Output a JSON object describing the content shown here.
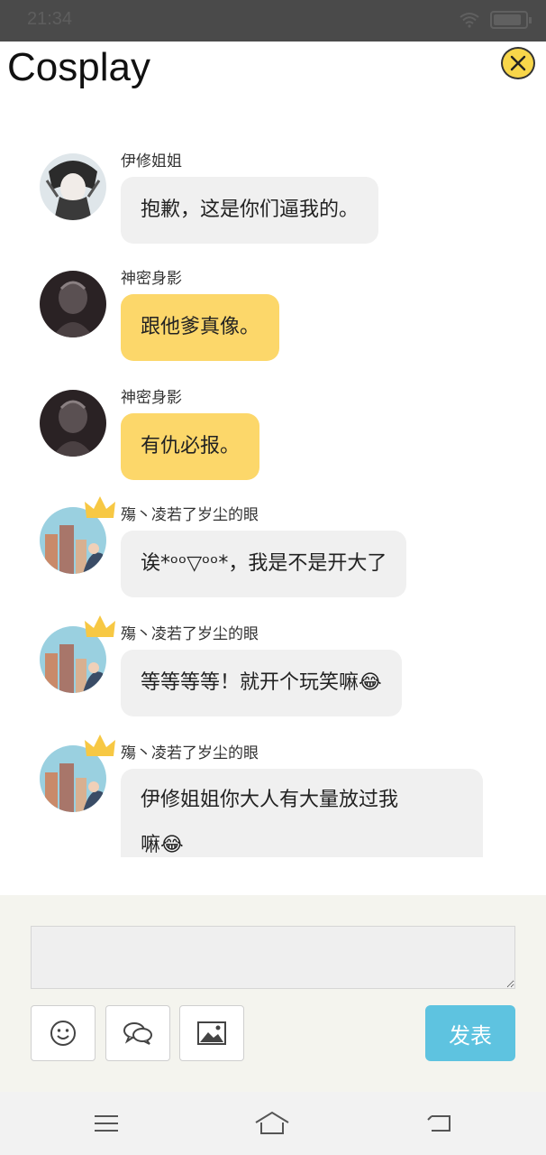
{
  "status_bar": {
    "time": "21:34"
  },
  "header": {
    "title": "Cosplay"
  },
  "messages": [
    {
      "sender": "伊修姐姐",
      "text": "抱歉，这是你们逼我的。",
      "style": "grey",
      "avatar": "avatar-ishu"
    },
    {
      "sender": "神密身影",
      "text": "跟他爹真像。",
      "style": "yellow",
      "avatar": "avatar-mystery"
    },
    {
      "sender": "神密身影",
      "text": "有仇必报。",
      "style": "yellow",
      "avatar": "avatar-mystery"
    },
    {
      "sender": "殤丶凌若了岁尘的眼",
      "text": "诶*ᵒᵒ▽ᵒᵒ*，我是不是开大了",
      "style": "grey",
      "avatar": "avatar-city"
    },
    {
      "sender": "殤丶凌若了岁尘的眼",
      "text": "等等等等！就开个玩笑嘛😂",
      "style": "grey",
      "avatar": "avatar-city"
    },
    {
      "sender": "殤丶凌若了岁尘的眼",
      "text_line1": "伊修姐姐你大人有大量放过我",
      "text_line2": "嘛😂",
      "style": "grey",
      "avatar": "avatar-city"
    }
  ],
  "composer": {
    "input_value": "",
    "send_label": "发表",
    "tools": [
      "smiley-icon",
      "chat-bubbles-icon",
      "image-icon"
    ]
  },
  "nav": {
    "icons": [
      "menu-icon",
      "home-icon",
      "back-icon"
    ]
  },
  "colors": {
    "accent_send": "#5ec3e0",
    "bubble_yellow": "#fcd76a",
    "bubble_grey": "#f0f0f0",
    "close_yellow": "#f8d64a"
  }
}
